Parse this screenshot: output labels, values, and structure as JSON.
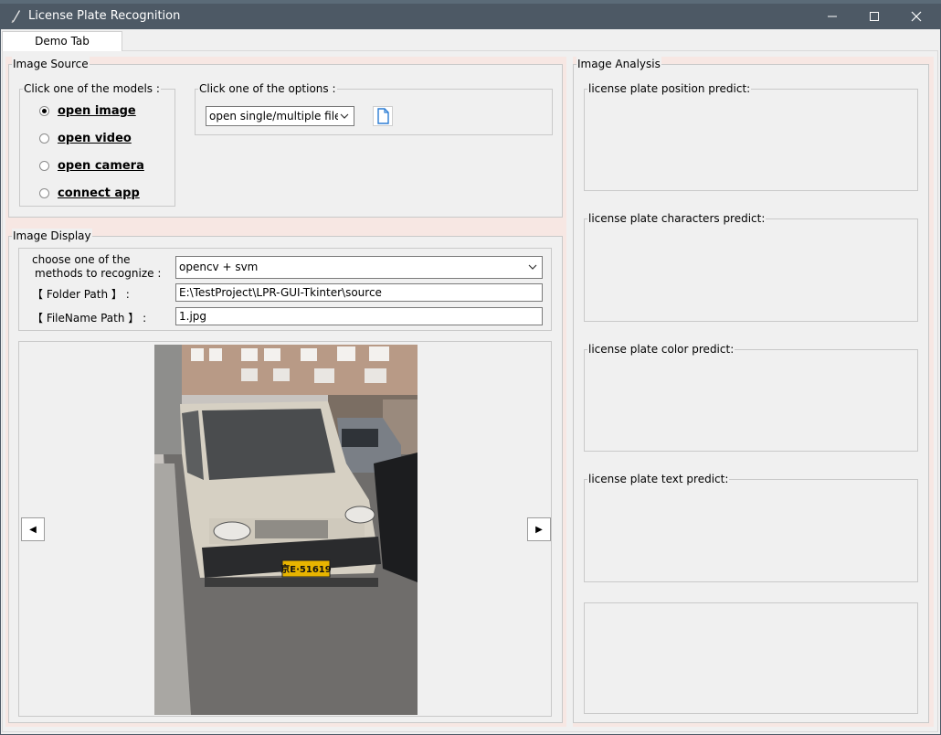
{
  "window": {
    "title": "License Plate Recognition"
  },
  "tabs": [
    {
      "label": "Demo Tab"
    }
  ],
  "image_source": {
    "title": "Image Source",
    "models_group": {
      "title": "Click one of the models :",
      "options": [
        {
          "label": "open image",
          "selected": true
        },
        {
          "label": "open video",
          "selected": false
        },
        {
          "label": "open camera",
          "selected": false
        },
        {
          "label": "connect app",
          "selected": false
        }
      ]
    },
    "options_group": {
      "title": "Click one of the options :",
      "select_value": "open single/multiple files"
    }
  },
  "image_display": {
    "title": "Image Display",
    "method_label_line1": "choose one of the",
    "method_label_line2": "methods to recognize :",
    "method_value": "opencv + svm",
    "folder_label": "【 Folder Path 】 :",
    "folder_value": "E:\\TestProject\\LPR-GUI-Tkinter\\source",
    "filename_label": "【 FileName Path 】 :",
    "filename_value": "1.jpg",
    "prev_label": "◀",
    "next_label": "▶",
    "plate_text": "京E·51619"
  },
  "image_analysis": {
    "title": "Image Analysis",
    "panels": [
      {
        "title": "license plate position predict:"
      },
      {
        "title": "license plate characters predict:"
      },
      {
        "title": "license plate color predict:"
      },
      {
        "title": "license plate text predict:"
      }
    ]
  },
  "colors": {
    "titlebar": "#4d5965",
    "pane_pink": "#f7e7e3",
    "plate_yellow": "#e8b400"
  }
}
